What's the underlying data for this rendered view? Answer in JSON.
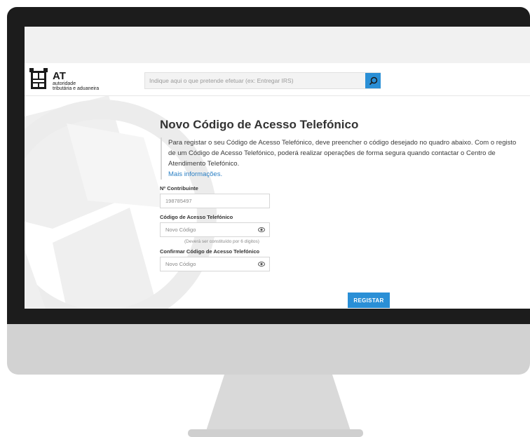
{
  "header": {
    "logo": {
      "mark": "AT",
      "line1": "autoridade",
      "line2": "tributária e aduaneira"
    },
    "search": {
      "placeholder": "Indique aqui o que pretende efetuar (ex: Entregar IRS)",
      "icon": "search-icon"
    }
  },
  "main": {
    "title": "Novo Código de Acesso Telefónico",
    "description": "Para registar o seu Código de Acesso Telefónico, deve preencher o código desejado no quadro abaixo. Com o registo de um Código de Acesso Telefónico, poderá realizar operações de forma segura quando contactar o Centro de Atendimento Telefónico.",
    "more_link": "Mais informações.",
    "form": {
      "nif_label": "Nº Contribuinte",
      "nif_value": "198785497",
      "code_label": "Código de Acesso Telefónico",
      "code_placeholder": "Novo Código",
      "code_hint": "(Deverá ser constituído por 6 dígitos)",
      "confirm_label": "Confirmar Código de Acesso Telefónico",
      "confirm_placeholder": "Novo Código",
      "eye_icon": "eye-icon",
      "submit": "REGISTAR"
    }
  },
  "colors": {
    "accent": "#2a8fd6",
    "link": "#2a7fc4",
    "bezel": "#1c1c1c",
    "chin": "#d2d2d2"
  }
}
